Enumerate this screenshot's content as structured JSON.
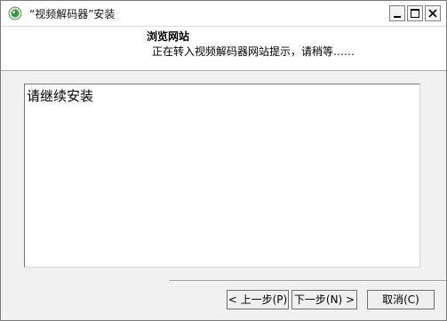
{
  "window": {
    "title": "“视频解码器”安装",
    "controls": {
      "minimize": "minimize",
      "maximize": "maximize",
      "close": "close"
    }
  },
  "header": {
    "title": "浏览网站",
    "subtitle": "正在转入视频解码器网站提示，请稍等……"
  },
  "content": {
    "text": "请继续安装"
  },
  "buttons": {
    "back": "< 上一步(P)",
    "next": "下一步(N) >",
    "cancel": "取消(C)"
  },
  "icons": {
    "app": "installer-shield-icon"
  },
  "colors": {
    "window_bg": "#f0f0f0",
    "header_bg": "#ffffff",
    "content_bg": "#ffffff",
    "icon_green": "#3a9a3a"
  }
}
